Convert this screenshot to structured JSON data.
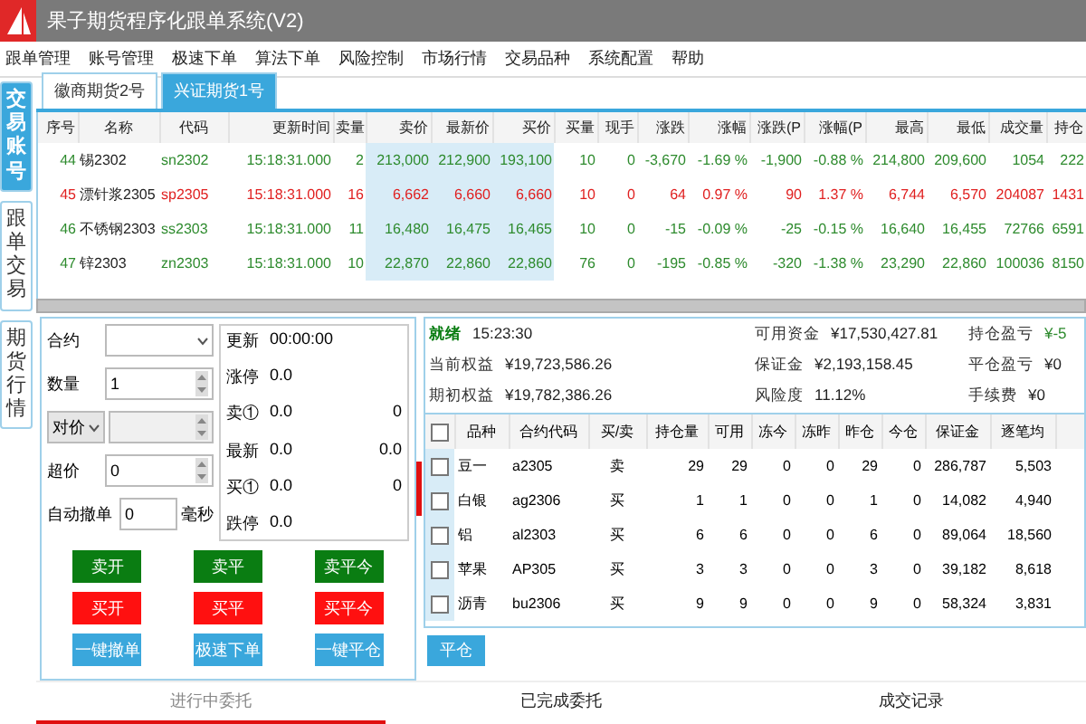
{
  "window": {
    "title": "果子期货程序化跟单系统(V2)"
  },
  "menu": [
    "跟单管理",
    "账号管理",
    "极速下单",
    "算法下单",
    "风险控制",
    "市场行情",
    "交易品种",
    "系统配置",
    "帮助"
  ],
  "side_tabs": [
    {
      "label": "交易账号",
      "selected": true
    },
    {
      "label": "跟单交易",
      "selected": false
    },
    {
      "label": "期货行情",
      "selected": false
    }
  ],
  "account_tabs": [
    {
      "label": "徽商期货2号",
      "selected": false
    },
    {
      "label": "兴证期货1号",
      "selected": true
    }
  ],
  "quotes": {
    "columns": [
      "序号",
      "名称",
      "代码",
      "更新时间",
      "卖量",
      "卖价",
      "最新价",
      "买价",
      "买量",
      "现手",
      "涨跌",
      "涨幅",
      "涨跌(P",
      "涨幅(P",
      "最高",
      "最低",
      "成交量",
      "持仓"
    ],
    "rows": [
      {
        "kind": "fall",
        "cells": [
          "44",
          "锡2302",
          "sn2302",
          "15:18:31.000",
          "2",
          "213,000",
          "212,900",
          "193,100",
          "10",
          "0",
          "-3,670",
          "-1.69 %",
          "-1,900",
          "-0.88 %",
          "214,800",
          "209,600",
          "1054",
          "222"
        ]
      },
      {
        "kind": "rise",
        "cells": [
          "45",
          "漂针浆2305",
          "sp2305",
          "15:18:31.000",
          "16",
          "6,662",
          "6,660",
          "6,660",
          "10",
          "0",
          "64",
          "0.97 %",
          "90",
          "1.37 %",
          "6,744",
          "6,570",
          "204087",
          "1431"
        ]
      },
      {
        "kind": "fall",
        "cells": [
          "46",
          "不锈钢2303",
          "ss2303",
          "15:18:31.000",
          "11",
          "16,480",
          "16,475",
          "16,465",
          "10",
          "0",
          "-15",
          "-0.09 %",
          "-25",
          "-0.15 %",
          "16,640",
          "16,455",
          "72766",
          "6591"
        ]
      },
      {
        "kind": "fall",
        "cells": [
          "47",
          "锌2303",
          "zn2303",
          "15:18:31.000",
          "10",
          "22,870",
          "22,860",
          "22,860",
          "76",
          "0",
          "-195",
          "-0.85 %",
          "-320",
          "-1.38 %",
          "23,290",
          "22,860",
          "100036",
          "8150"
        ]
      }
    ]
  },
  "order": {
    "contract_label": "合约",
    "quantity_label": "数量",
    "quantity": "1",
    "price_type": "对价",
    "over_label": "超价",
    "over": "0",
    "cancel_label": "自动撤单",
    "cancel": "0",
    "cancel_unit": "毫秒",
    "quote": [
      {
        "label": "更新",
        "value": "00:00:00"
      },
      {
        "label": "涨停",
        "value": "0.0"
      },
      {
        "label": "卖①",
        "value": "0.0",
        "extra": "0"
      },
      {
        "label": "最新",
        "value": "0.0",
        "extra": "0.0"
      },
      {
        "label": "买①",
        "value": "0.0",
        "extra": "0"
      },
      {
        "label": "跌停",
        "value": "0.0"
      }
    ],
    "buttons": [
      {
        "label": "卖开",
        "kind": "sell"
      },
      {
        "label": "卖平",
        "kind": "sell"
      },
      {
        "label": "卖平今",
        "kind": "sell"
      },
      {
        "label": "买开",
        "kind": "buy"
      },
      {
        "label": "买平",
        "kind": "buy"
      },
      {
        "label": "买平今",
        "kind": "buy"
      },
      {
        "label": "一键撤单",
        "kind": "action"
      },
      {
        "label": "极速下单",
        "kind": "action"
      },
      {
        "label": "一键平仓",
        "kind": "action"
      }
    ]
  },
  "account": {
    "status": "就绪",
    "time": "15:23:30",
    "fields": [
      {
        "label": "可用资金",
        "value": "¥17,530,427.81"
      },
      {
        "label": "持仓盈亏",
        "value": "¥-5",
        "kind": "profit"
      },
      {
        "label": "当前权益",
        "value": "¥19,723,586.26"
      },
      {
        "label": "保证金",
        "value": "¥2,193,158.45"
      },
      {
        "label": "平仓盈亏",
        "value": "¥0"
      },
      {
        "label": "期初权益",
        "value": "¥19,782,386.26"
      },
      {
        "label": "风险度",
        "value": "11.12%"
      },
      {
        "label": "手续费",
        "value": "¥0"
      }
    ]
  },
  "positions": {
    "all_checked": false,
    "columns": [
      "品种",
      "合约代码",
      "买/卖",
      "持仓量",
      "可用",
      "冻今",
      "冻昨",
      "昨仓",
      "今仓",
      "保证金",
      "逐笔均"
    ],
    "rows": [
      {
        "checked": false,
        "cells": [
          "豆一",
          "a2305",
          "卖",
          "29",
          "29",
          "0",
          "0",
          "29",
          "0",
          "286,787",
          "5,503"
        ]
      },
      {
        "checked": false,
        "cells": [
          "白银",
          "ag2306",
          "买",
          "1",
          "1",
          "0",
          "0",
          "1",
          "0",
          "14,082",
          "4,940"
        ]
      },
      {
        "checked": false,
        "cells": [
          "铝",
          "al2303",
          "买",
          "6",
          "6",
          "0",
          "0",
          "6",
          "0",
          "89,064",
          "18,560"
        ]
      },
      {
        "checked": false,
        "cells": [
          "苹果",
          "AP305",
          "买",
          "3",
          "3",
          "0",
          "0",
          "3",
          "0",
          "39,182",
          "8,618"
        ]
      },
      {
        "checked": false,
        "cells": [
          "沥青",
          "bu2306",
          "买",
          "9",
          "9",
          "0",
          "0",
          "9",
          "0",
          "58,324",
          "3,831"
        ]
      }
    ],
    "close_button": "平仓"
  },
  "bottom_tabs": [
    {
      "label": "进行中委托",
      "selected": true
    },
    {
      "label": "已完成委托",
      "selected": false
    },
    {
      "label": "成交记录",
      "selected": false
    }
  ]
}
